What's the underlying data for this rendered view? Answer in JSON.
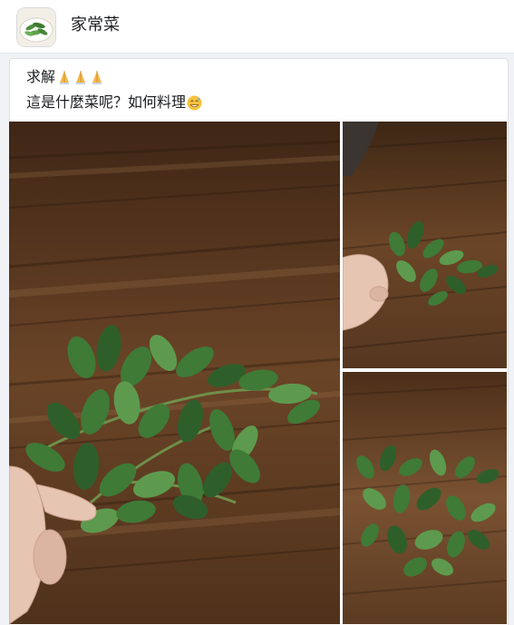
{
  "group": {
    "name": "家常菜",
    "avatar_icon": "vegetable-dish-icon"
  },
  "post": {
    "line1": "求解",
    "line1_emojis": [
      "folded-hands-emoji",
      "folded-hands-emoji",
      "folded-hands-emoji"
    ],
    "line2": "這是什麼菜呢？如何料理",
    "line2_emoji": "grinning-sweat-emoji"
  },
  "photos": [
    {
      "subject": "vegetable-sprigs-on-wood-table-with-hand"
    },
    {
      "subject": "vegetable-sprigs-held-in-hand"
    },
    {
      "subject": "vegetable-sprigs-on-wood-table"
    }
  ],
  "colors": {
    "wood_dark": "#4a2f1a",
    "wood_mid": "#6b4a2c",
    "wood_light": "#8a6440",
    "leaf_dark": "#2e5f2b",
    "leaf_mid": "#3f7a37",
    "leaf_light": "#5d9a4e",
    "skin": "#e9c8b8"
  }
}
